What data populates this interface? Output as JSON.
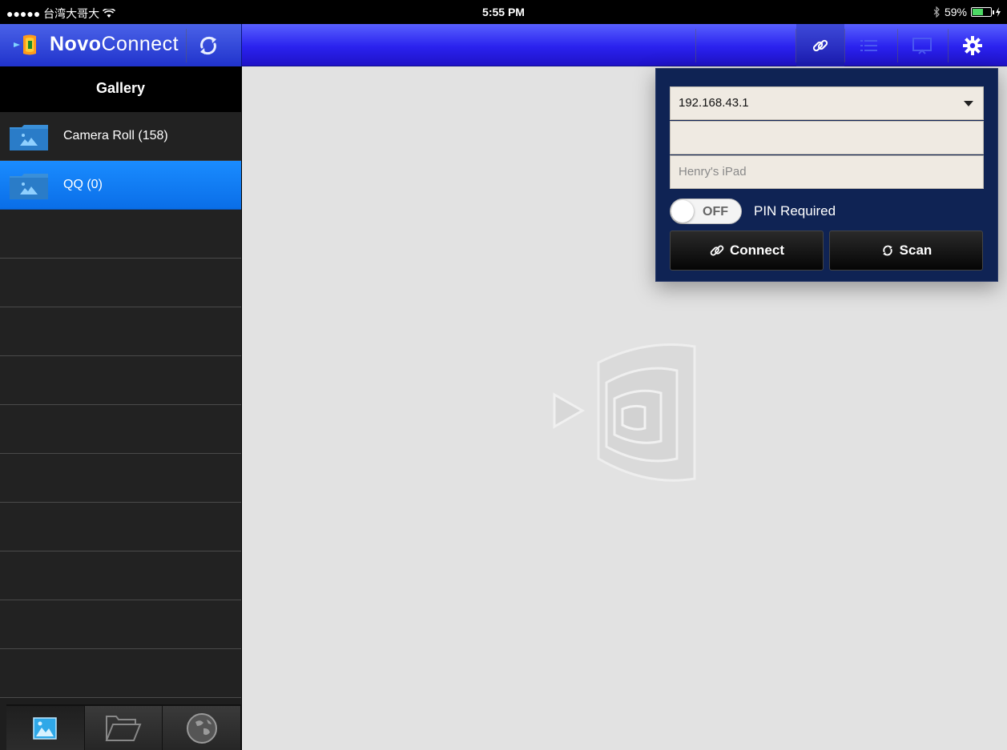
{
  "status_bar": {
    "carrier": "●●●●● 台湾大哥大",
    "time": "5:55 PM",
    "battery_text": "59%",
    "battery_level": 0.59
  },
  "nav": {
    "title_bold": "Novo",
    "title_regular": "Connect"
  },
  "sidebar": {
    "header": "Gallery",
    "items": [
      {
        "label": "Camera Roll (158)",
        "selected": false
      },
      {
        "label": "QQ (0)",
        "selected": true
      }
    ]
  },
  "popover": {
    "ip_value": "192.168.43.1",
    "pin_value": "",
    "device_name_placeholder": "Henry's iPad",
    "toggle_state": "OFF",
    "pin_required_label": "PIN Required",
    "connect_label": "Connect",
    "scan_label": "Scan"
  },
  "colors": {
    "nav_blue": "#2a22ee",
    "selection_blue": "#1a8cff",
    "popover_bg": "#0f2354"
  },
  "icons": [
    "refresh-icon",
    "link-icon",
    "list-icon",
    "screen-icon",
    "gear-icon",
    "gallery-icon",
    "folder-open-icon",
    "globe-icon"
  ]
}
